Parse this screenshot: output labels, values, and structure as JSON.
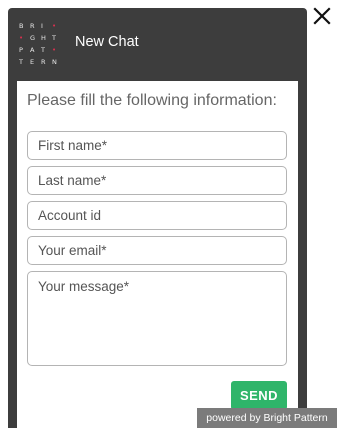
{
  "header": {
    "title": "New Chat",
    "logo_rows": [
      [
        "B",
        "R",
        "I",
        "•"
      ],
      [
        "•",
        "G",
        "H",
        "T"
      ],
      [
        "P",
        "A",
        "T",
        "•"
      ],
      [
        "T",
        "E",
        "R",
        "N"
      ]
    ]
  },
  "form": {
    "instructions": "Please fill the following information:",
    "first_name_placeholder": "First name*",
    "last_name_placeholder": "Last name*",
    "account_id_placeholder": "Account id",
    "email_placeholder": "Your email*",
    "message_placeholder": "Your message*",
    "send_label": "SEND"
  },
  "footer": {
    "powered_by": "powered by Bright Pattern"
  },
  "colors": {
    "panel_bg": "#3d3d3d",
    "send_button": "#2fb56a",
    "logo_accent": "#d8304f",
    "powered_bg": "#7b7b7b"
  },
  "icons": {
    "close": "close-icon"
  }
}
